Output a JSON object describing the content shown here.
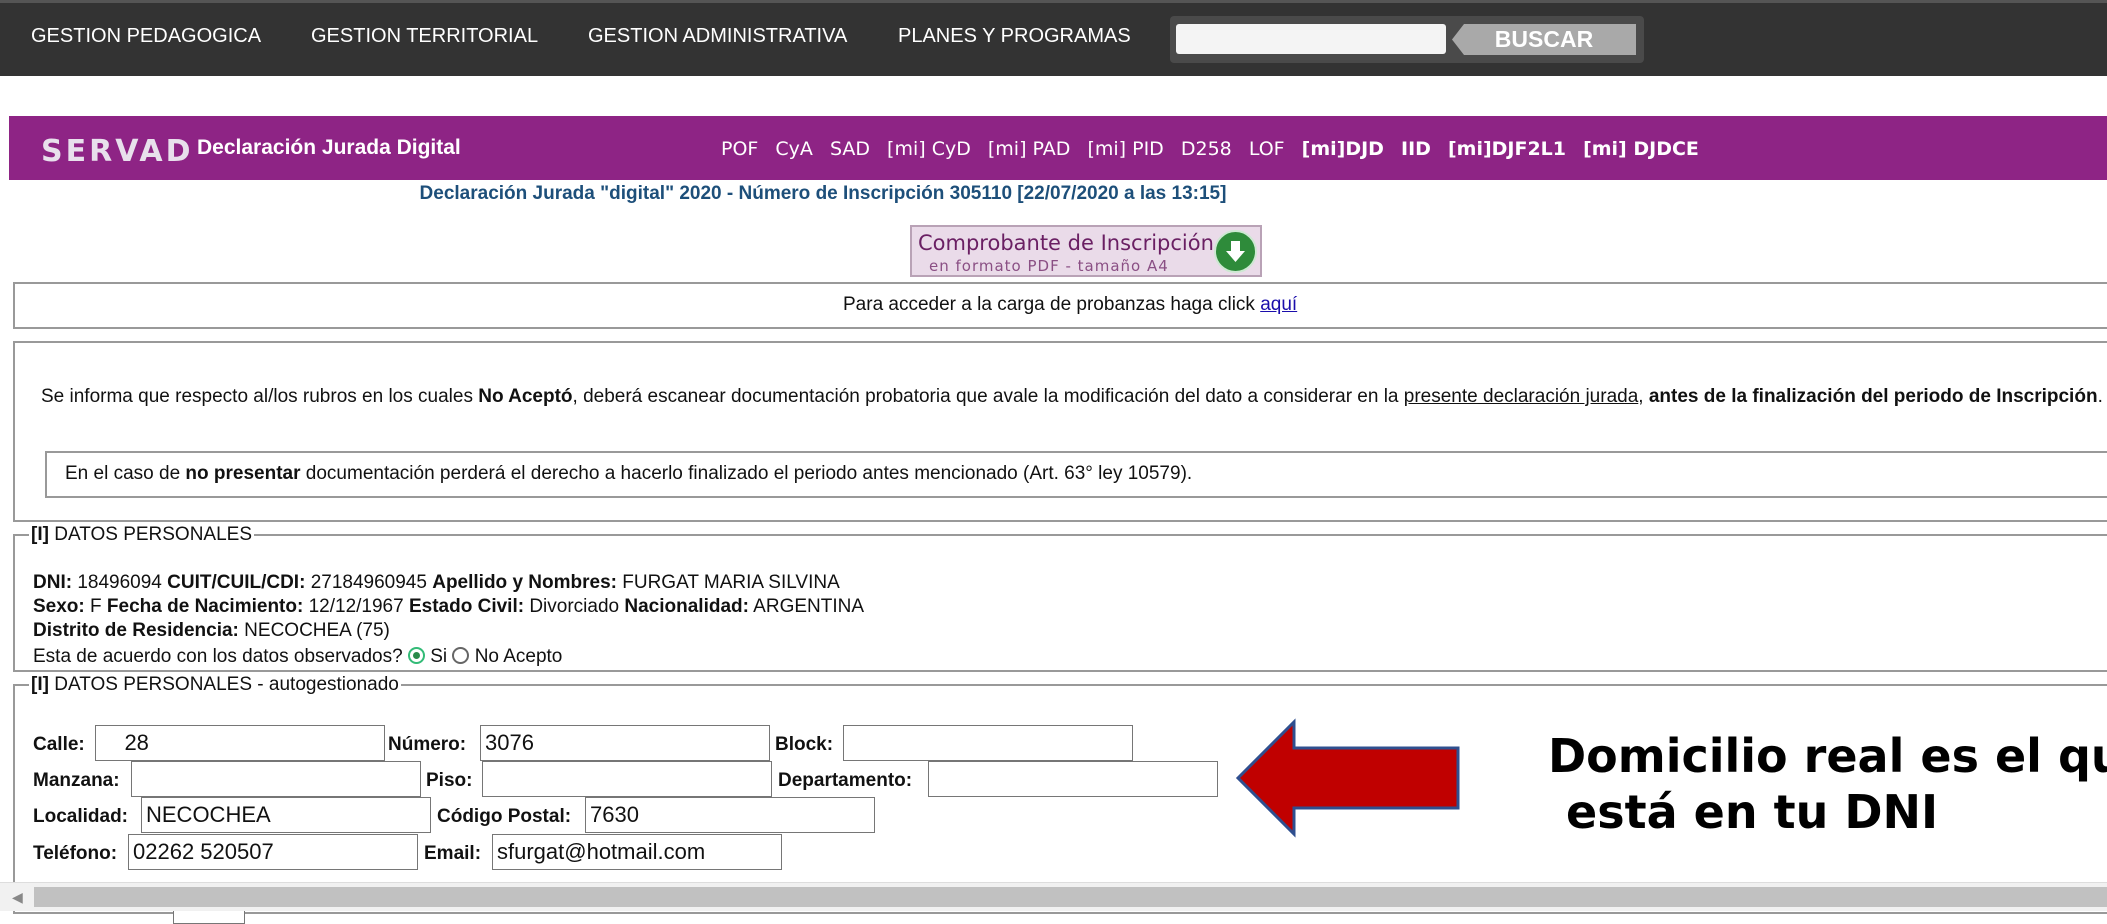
{
  "nav": {
    "items": [
      "GESTION PEDAGOGICA",
      "GESTION TERRITORIAL",
      "GESTION ADMINISTRATIVA",
      "PLANES Y PROGRAMAS"
    ],
    "search_value": "",
    "search_button": "BUSCAR"
  },
  "header": {
    "logo": "SERVAD",
    "title": "Declaración Jurada Digital",
    "links": [
      "POF",
      "CyA",
      "SAD",
      "[mi] CyD",
      "[mi] PAD",
      "[mi] PID",
      "D258",
      "LOF",
      "[mi]DJD",
      "IID",
      "[mi]DJF2L1",
      "[mi] DJDCE"
    ]
  },
  "subtitle": "Declaración Jurada \"digital\" 2020 - Número de Inscripción 305110 [22/07/2020 a las 13:15]",
  "pdf_button": {
    "line1": "Comprobante de Inscripción",
    "line2": "en formato PDF - tamaño A4"
  },
  "probanzas": {
    "text": "Para acceder a la carga de probanzas haga click ",
    "link": "aquí"
  },
  "notice": {
    "p1": "Se informa que respecto al/los rubros en los cuales ",
    "p1_bold": "No Aceptó",
    "p2": ", deberá escanear documentación probatoria que avale la modificación del dato a considerar en la ",
    "p2_link": "presente declaración jurada",
    "p3": ", ",
    "p3_bold": "antes de la finalización del periodo de Inscripción",
    "p4": ".",
    "inner_a": "En el caso de ",
    "inner_bold": "no presentar",
    "inner_b": " documentación perderá el derecho a hacerlo finalizado el periodo antes mencionado (Art. 63° ley 10579)."
  },
  "personal": {
    "legend_tag": "[I]",
    "legend": " DATOS PERSONALES",
    "dni_label": "DNI:",
    "dni": " 18496094 ",
    "cuit_label": "CUIT/CUIL/CDI:",
    "cuit": " 27184960945 ",
    "name_label": "Apellido y Nombres:",
    "name": " FURGAT MARIA SILVINA",
    "sexo_label": "Sexo:",
    "sexo": " F ",
    "nac_label": "Fecha de Nacimiento:",
    "nac": " 12/12/1967 ",
    "civil_label": "Estado Civil:",
    "civil": " Divorciado ",
    "nacion_label": "Nacionalidad:",
    "nacion": " ARGENTINA",
    "distrito_label": "Distrito de Residencia:",
    "distrito": " NECOCHEA (75)",
    "question": "Esta de acuerdo con los datos observados? ",
    "opt_si": " Si ",
    "opt_no": " No Acepto",
    "selected": "Si"
  },
  "auto": {
    "legend_tag": "[I]",
    "legend": " DATOS PERSONALES - autogestionado",
    "calle_label": "Calle:",
    "calle": "    28",
    "numero_label": "Número:",
    "numero": "3076",
    "block_label": "Block:",
    "block": "",
    "manzana_label": "Manzana:",
    "manzana": "",
    "piso_label": "Piso:",
    "piso": "",
    "depto_label": "Departamento:",
    "depto": "",
    "localidad_label": "Localidad:",
    "localidad": "NECOCHEA",
    "cp_label": "Código Postal:",
    "cp": "7630",
    "telefono_label": "Teléfono:",
    "telefono": "02262 520507",
    "email_label": "Email:",
    "email": "sfurgat@hotmail.com"
  },
  "annotation": {
    "line1": "Domicilio real es el qu",
    "line2": "está en tu DNI"
  },
  "colors": {
    "nav_bg": "#333333",
    "banner_bg": "#8e2485",
    "arrow_fill": "#c00000",
    "arrow_stroke": "#2f4f8f"
  }
}
